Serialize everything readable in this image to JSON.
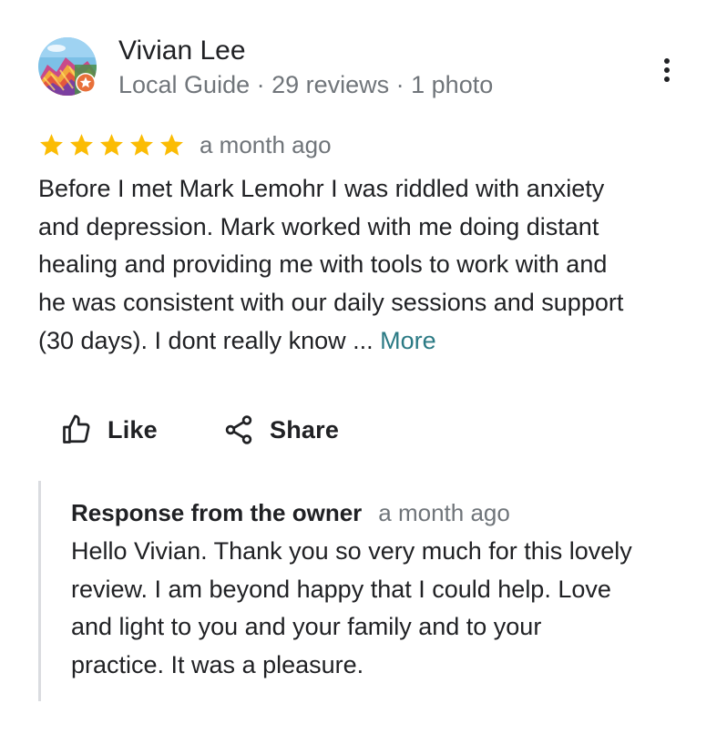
{
  "reviewer": {
    "name": "Vivian Lee",
    "meta": "Local Guide · 29 reviews · 1 photo",
    "avatar_icon": "colorful-mountains-photo",
    "badge_icon": "local-guide-star-badge"
  },
  "more_options_icon": "three-dot-vertical-icon",
  "rating": {
    "stars": 5,
    "max": 5,
    "star_color": "#fbbc04",
    "date": "a month ago"
  },
  "review": {
    "lines": [
      "Before I met Mark Lemohr I was riddled with anxiety",
      "and depression.  Mark worked with me doing distant",
      "healing and providing me with tools to work with and",
      "he was consistent with our daily sessions and support",
      "(30 days).  I dont really know ... "
    ],
    "more_label": "More",
    "more_color": "#2b7a84"
  },
  "actions": {
    "like_label": "Like",
    "share_label": "Share"
  },
  "owner_response": {
    "title": "Response from the owner",
    "date": "a month ago",
    "lines": [
      "Hello Vivian. Thank you so very much for this lovely",
      "review. I am beyond happy that I could help. Love",
      "and light to you and your family and to your",
      "practice. It was a pleasure."
    ]
  }
}
